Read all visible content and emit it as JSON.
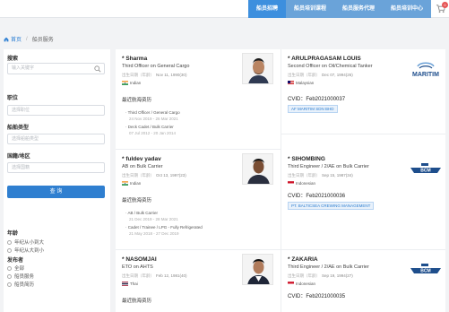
{
  "nav": {
    "items": [
      {
        "label": "船员招聘",
        "active": true
      },
      {
        "label": "船员培训课程",
        "active": false
      },
      {
        "label": "船员服务代理",
        "active": false
      },
      {
        "label": "船员培训中心",
        "active": false
      }
    ],
    "cart_count": "0"
  },
  "breadcrumb": {
    "home": "首页",
    "current": "船员服务"
  },
  "sidebar": {
    "search_label": "搜索",
    "search_placeholder": "输入关键字",
    "position_label": "职位",
    "position_placeholder": "选择职位",
    "ship_type_label": "船舶类型",
    "ship_type_placeholder": "选择船舶类型",
    "nationality_label": "国籍/地区",
    "nationality_placeholder": "选择国籍",
    "search_button": "查 询",
    "age_label": "年龄",
    "age_options": [
      "年纪从小到大",
      "年纪从大到小"
    ],
    "publisher_label": "发布者",
    "publisher_options": [
      "全部",
      "船员服务",
      "船员简历"
    ]
  },
  "cards_left": [
    {
      "name": "* Sharma",
      "rank": "Third Officer on General Cargo",
      "birth_label": "出生日期（年龄）",
      "birth": "Nov 11, 1990(30)",
      "nationality": "Indian",
      "exp_title": "最近航海资历",
      "experience": [
        {
          "role": "Third Officer / General Cargo",
          "dates": "24 Nov 2019 - 26 Mar 2021"
        },
        {
          "role": "Deck Cadet / Bulk Carrier",
          "dates": "07 Jul 2012 - 20 Jan 2014"
        }
      ]
    },
    {
      "name": "* fuldev yadav",
      "rank": "AB on Bulk Carrier",
      "birth_label": "出生日期（年龄）",
      "birth": "Oct 13, 1997(23)",
      "nationality": "Indian",
      "exp_title": "最近航海资历",
      "experience": [
        {
          "role": "AB / Bulk Carrier",
          "dates": "21 Dec 2019 - 28 Mar 2021"
        },
        {
          "role": "Cadet / Trainee / LPG - Fully Refrigerated",
          "dates": "21 May 2018 - 27 Dec 2019"
        }
      ]
    },
    {
      "name": "* NASOMJAI",
      "rank": "ETO on AHTS",
      "birth_label": "出生日期（年龄）",
      "birth": "Feb 12, 1981(40)",
      "nationality": "Thai",
      "exp_title": "最近航海资历",
      "experience": []
    }
  ],
  "cards_right": [
    {
      "name": "* ARULPRAGASAM LOUIS",
      "rank": "Second Officer on Oil/Chemical Tanker",
      "birth_label": "出生日期（年龄）",
      "birth": "Dec 07, 1994(26)",
      "nationality": "Malaysian",
      "cvid": "CVID：Feb2021000037",
      "company": "AF MARITIM SDN BHD",
      "logo_text": "MARITIM"
    },
    {
      "name": "* SIHOMBING",
      "rank": "Third Engineer / 2/AE on Bulk Carrier",
      "birth_label": "出生日期（年龄）",
      "birth": "Sep 15, 1987(34)",
      "nationality": "Indonesian",
      "cvid": "CVID：Feb2021000036",
      "company": "PT. BALTICSEA CREWING MANAGEMENT",
      "logo_text": "BCM"
    },
    {
      "name": "* ZAKARIA",
      "rank": "Third Engineer / 2/AE on Bulk Carrier",
      "birth_label": "出生日期（年龄）",
      "birth": "Sep 19, 1994(27)",
      "nationality": "Indonesian",
      "cvid": "CVID：Feb2021000035",
      "company": "",
      "logo_text": "BCM"
    }
  ],
  "colors": {
    "accent": "#2f7fd0",
    "nav_active": "#3d8fde",
    "badge": "#e55353"
  }
}
